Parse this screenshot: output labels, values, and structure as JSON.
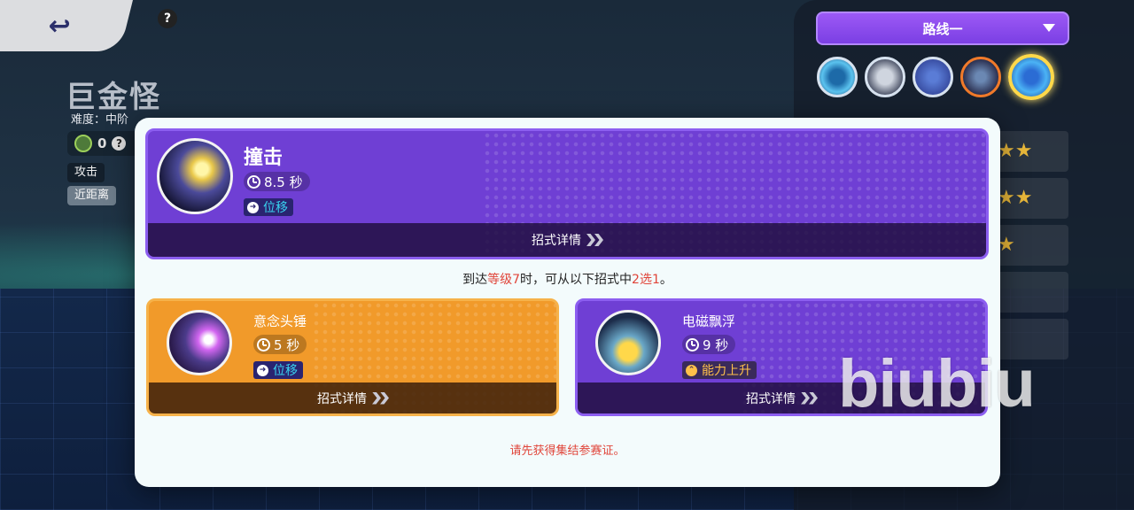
{
  "top": {
    "back_icon": "back-arrow-icon",
    "help_glyph": "?"
  },
  "pokemon": {
    "name": "巨金怪",
    "difficulty": "难度：中阶",
    "score": "0",
    "score_help": "?",
    "tags": [
      "攻击",
      "近距离"
    ]
  },
  "route": {
    "selected": "路线一"
  },
  "skill_icons": [
    "gear-skill-icon",
    "shell-skill-icon",
    "psychic-skill-icon",
    "dash-skill-icon",
    "selected-skill-icon"
  ],
  "ratings": [
    "★★",
    "★★",
    "★",
    "",
    ""
  ],
  "main_move": {
    "name": "撞击",
    "cooldown": "8.5 秒",
    "type": "位移",
    "details_label": "招式详情"
  },
  "unlock": {
    "prefix": "到达",
    "level": "等级7",
    "middle": "时，可从以下招式中",
    "choice": "2选1",
    "suffix": "。"
  },
  "options": [
    {
      "name": "意念头锤",
      "cooldown": "5 秒",
      "type": "位移",
      "details_label": "招式详情"
    },
    {
      "name": "电磁飘浮",
      "cooldown": "9 秒",
      "type": "能力上升",
      "details_label": "招式详情"
    }
  ],
  "notice": "请先获得集结参赛证。",
  "watermark": "biubiu",
  "colors": {
    "purple": "#6f3fd4",
    "orange": "#f19a2a",
    "accent_red": "#e0453a",
    "route_purple": "#9c59f5"
  }
}
